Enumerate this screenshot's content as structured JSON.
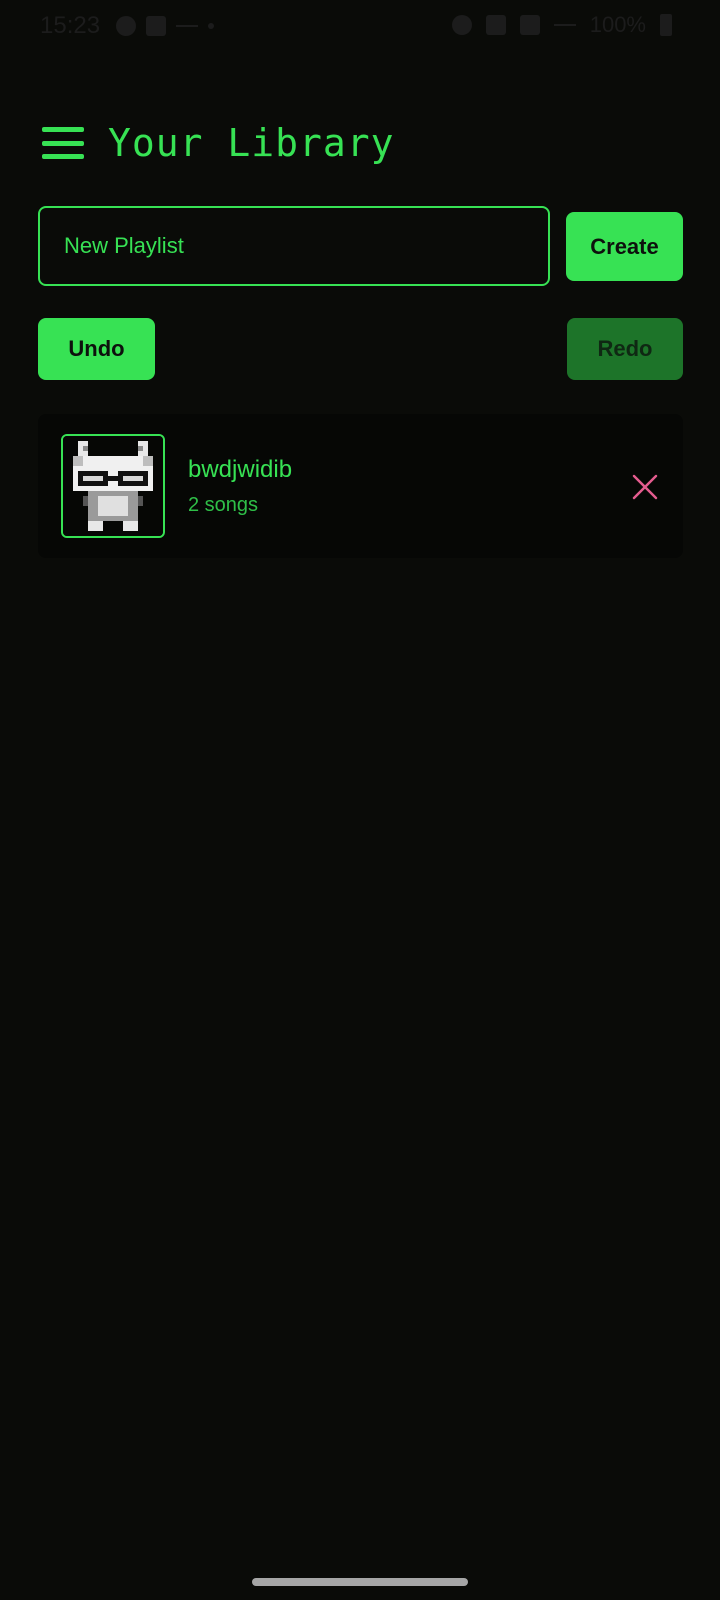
{
  "status_bar": {
    "time": "15:23",
    "battery": "100%"
  },
  "header": {
    "title": "Your Library"
  },
  "new_playlist": {
    "placeholder": "New Playlist",
    "create_label": "Create"
  },
  "history": {
    "undo_label": "Undo",
    "redo_label": "Redo"
  },
  "playlists": [
    {
      "name": "bwdjwidib",
      "count": "2 songs",
      "thumbnail_icon": "pixel-cat-icon",
      "remove_icon": "close-icon"
    }
  ],
  "colors": {
    "background": "#0a0b08",
    "accent": "#37e254",
    "accent_dim": "#1d7429",
    "remove": "#e45c8f"
  }
}
